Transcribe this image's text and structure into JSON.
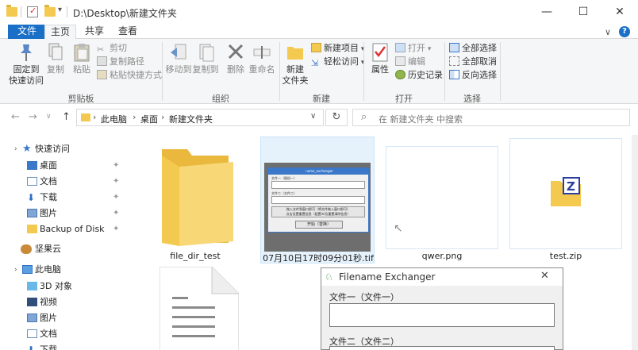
{
  "window": {
    "title": "D:\\Desktop\\新建文件夹",
    "minimize": "—",
    "maximize": "☐",
    "close": "✕"
  },
  "tabs": {
    "file": "文件",
    "home": "主页",
    "share": "共享",
    "view": "查看"
  },
  "ribbon": {
    "clipboard": {
      "label": "剪贴板",
      "pin": "固定到\n快速访问",
      "pin_l1": "固定到",
      "pin_l2": "快速访问",
      "copy": "复制",
      "paste": "粘贴",
      "cut": "剪切",
      "copy_path": "复制路径",
      "paste_shortcut": "粘贴快捷方式"
    },
    "organize": {
      "label": "组织",
      "move_to": "移动到",
      "copy_to": "复制到",
      "delete": "删除",
      "rename": "重命名"
    },
    "new": {
      "label": "新建",
      "new_folder_l1": "新建",
      "new_folder_l2": "文件夹",
      "new_item": "新建项目",
      "easy_access": "轻松访问"
    },
    "open": {
      "label": "打开",
      "properties": "属性",
      "open": "打开",
      "edit": "编辑",
      "history": "历史记录"
    },
    "select": {
      "label": "选择",
      "select_all": "全部选择",
      "select_none": "全部取消",
      "invert": "反向选择"
    }
  },
  "nav": {
    "back": "←",
    "forward": "→",
    "recent": "∨",
    "up": "↑",
    "breadcrumbs": [
      "此电脑",
      "桌面",
      "新建文件夹"
    ],
    "refresh": "↻",
    "search_placeholder": "在 新建文件夹 中搜索"
  },
  "sidebar": {
    "quick_access": "快速访问",
    "items": [
      {
        "label": "桌面",
        "pinned": true
      },
      {
        "label": "文档",
        "pinned": true
      },
      {
        "label": "下载",
        "pinned": true
      },
      {
        "label": "图片",
        "pinned": true
      },
      {
        "label": "Backup of Disk",
        "pinned": true
      }
    ],
    "jianguoyun": "坚果云",
    "this_pc": "此电脑",
    "pc_items": [
      "3D 对象",
      "视频",
      "图片",
      "文档",
      "下载"
    ]
  },
  "files": [
    {
      "name": "file_dir_test",
      "type": "folder"
    },
    {
      "name": "07月10日17时09分01秒.tif",
      "type": "image"
    },
    {
      "name": "qwer.png",
      "type": "image"
    },
    {
      "name": "test.zip",
      "type": "zip"
    }
  ],
  "thumb_dialog": {
    "title": "name_exchanger",
    "field1": "文件一（随机一）",
    "field2": "文件二（文件二）",
    "hint1": "拖入文件到窗口即可（将文件拖入窗口即可）",
    "hint2": "点击设置重置信息（配置ini及重置清除信息）",
    "start": "开始（替换）"
  },
  "dialog": {
    "title": "Filename Exchanger",
    "close": "✕",
    "field1_label": "文件一（文件一）",
    "field2_label": "文件二（文件二）"
  },
  "colors": {
    "accent": "#1a6fc6",
    "folder": "#f3c94f"
  }
}
